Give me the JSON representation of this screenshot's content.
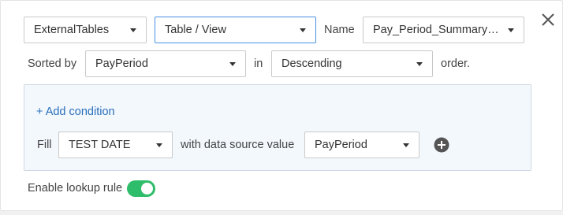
{
  "row1": {
    "source_select": "ExternalTables",
    "type_select": "Table / View",
    "name_label": "Name",
    "name_select": "Pay_Period_Summary_R..."
  },
  "row2": {
    "sorted_by_label": "Sorted by",
    "sort_field_select": "PayPeriod",
    "in_label": "in",
    "order_select": "Descending",
    "order_label": "order."
  },
  "condition": {
    "add_link": "+ Add condition",
    "fill_label": "Fill",
    "fill_select": "TEST DATE",
    "with_label": "with data source value",
    "value_select": "PayPeriod"
  },
  "footer": {
    "enable_label": "Enable lookup rule",
    "enable_on": true
  },
  "icons": {
    "close": "close-icon",
    "add_condition": "plus-circle-icon"
  },
  "colors": {
    "toggle_on": "#2ebd6b",
    "link": "#2a6fba",
    "focus_border": "#4a90e2",
    "condition_bg": "#f3f8fd"
  }
}
